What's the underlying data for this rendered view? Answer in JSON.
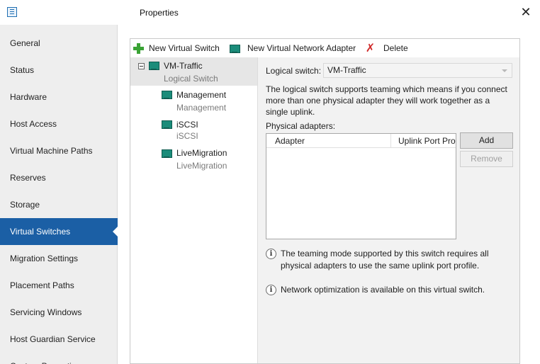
{
  "window": {
    "title": "Properties",
    "close_glyph": "✕",
    "icon": "properties-window-icon"
  },
  "nav": {
    "items": [
      {
        "label": "General"
      },
      {
        "label": "Status"
      },
      {
        "label": "Hardware"
      },
      {
        "label": "Host Access"
      },
      {
        "label": "Virtual Machine Paths"
      },
      {
        "label": "Reserves"
      },
      {
        "label": "Storage"
      },
      {
        "label": "Virtual Switches",
        "active": true
      },
      {
        "label": "Migration Settings"
      },
      {
        "label": "Placement Paths"
      },
      {
        "label": "Servicing Windows"
      },
      {
        "label": "Host Guardian Service"
      },
      {
        "label": "Custom Properties"
      }
    ]
  },
  "toolbar": {
    "new_switch": "New Virtual Switch",
    "new_adapter": "New Virtual Network Adapter",
    "delete": "Delete"
  },
  "tree": {
    "root": {
      "title": "VM-Traffic",
      "subtitle": "Logical Switch"
    },
    "children": [
      {
        "title": "Management",
        "subtitle": "Management"
      },
      {
        "title": "iSCSI",
        "subtitle": "iSCSI"
      },
      {
        "title": "LiveMigration",
        "subtitle": "LiveMigration"
      }
    ]
  },
  "details": {
    "logical_switch_label": "Logical switch:",
    "logical_switch_value": "VM-Traffic",
    "description": "The logical switch supports teaming which means if you connect more than one physical adapter they will work together as a single uplink.",
    "physical_adapters_label": "Physical adapters:",
    "columns": [
      "Adapter",
      "Uplink Port Profile"
    ],
    "rows": [],
    "add_button": "Add",
    "remove_button": "Remove",
    "info_teaming": "The teaming mode supported by this switch requires all physical adapters to use the same uplink port profile.",
    "info_optimization": "Network optimization is available on this virtual switch.",
    "info_glyph": "i"
  },
  "colors": {
    "nav_active": "#1b5fa5",
    "add_icon": "#3aa335",
    "delete_icon": "#d02a2a",
    "adapter_icon": "#1b8c7a"
  }
}
